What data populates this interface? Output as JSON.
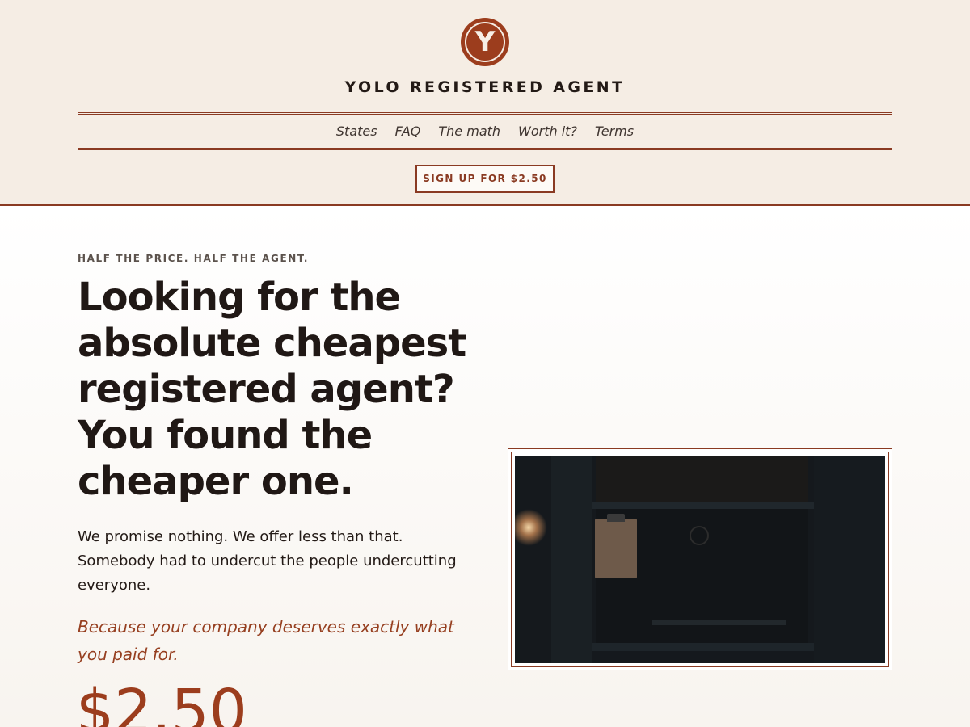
{
  "header": {
    "logo_letter": "Y",
    "brand": "YOLO REGISTERED AGENT",
    "nav": [
      {
        "label": "States"
      },
      {
        "label": "FAQ"
      },
      {
        "label": "The math"
      },
      {
        "label": "Worth it?"
      },
      {
        "label": "Terms"
      }
    ],
    "cta_label": "SIGN UP FOR $2.50"
  },
  "hero": {
    "eyebrow": "HALF THE PRICE. HALF THE AGENT.",
    "headline": "Looking for the absolute cheapest registered agent? You found the cheaper one.",
    "lede": "We promise nothing. We offer less than that. Somebody had to undercut the people undercutting everyone.",
    "tagline": "Because your company deserves exactly what you paid for.",
    "price": "$2.50"
  },
  "colors": {
    "accent": "#9c3d1d",
    "header_background": "#f5ede4",
    "text": "#231a16"
  },
  "icons": {
    "logo": "circle-y-logo-icon"
  }
}
